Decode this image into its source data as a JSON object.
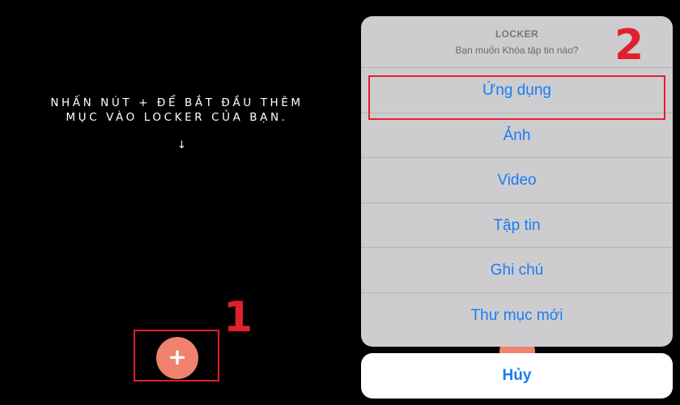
{
  "left_screen": {
    "empty_hint_line1": "NHẤN NÚT + ĐỂ BẮT ĐẦU THÊM",
    "empty_hint_line2": "MỤC VÀO LOCKER CỦA BẠN.",
    "down_arrow": "↓",
    "add_button_label": "+",
    "step_marker": "1"
  },
  "action_sheet": {
    "title": "LOCKER",
    "message": "Bạn muốn Khóa tập tin nào?",
    "actions": [
      {
        "label": "Ứng dụng"
      },
      {
        "label": "Ảnh"
      },
      {
        "label": "Video"
      },
      {
        "label": "Tập tin"
      },
      {
        "label": "Ghi chú"
      },
      {
        "label": "Thư mục mới"
      }
    ],
    "cancel_label": "Hủy",
    "step_marker": "2"
  },
  "colors": {
    "background": "#000000",
    "accent_button": "#f0826d",
    "action_text": "#1a7cf2",
    "sheet_background": "#cdcdd0",
    "highlight": "#e0202c"
  }
}
